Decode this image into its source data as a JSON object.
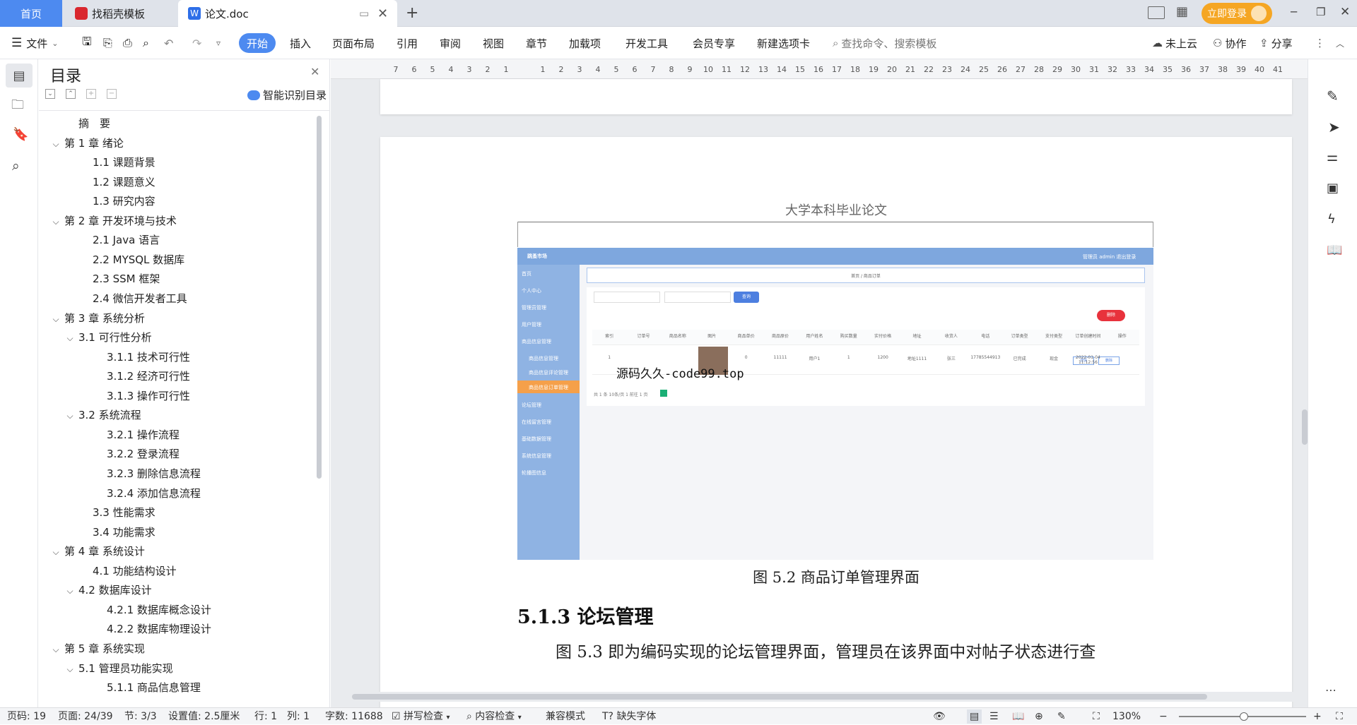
{
  "tabs": {
    "home": "首页",
    "template": "找稻壳模板",
    "doc": "论文.doc"
  },
  "titlebar": {
    "login_button": "立即登录"
  },
  "menu": {
    "file": "文件",
    "items": [
      "开始",
      "插入",
      "页面布局",
      "引用",
      "审阅",
      "视图",
      "章节",
      "加载项",
      "开发工具",
      "会员专享",
      "新建选项卡"
    ],
    "search_placeholder": "查找命令、搜索模板",
    "cloud": "未上云",
    "collab": "协作",
    "share": "分享"
  },
  "toc": {
    "title": "目录",
    "smart": "智能识别目录",
    "items": [
      "摘　要",
      "第 1 章  绪论",
      "1.1  课题背景",
      "1.2  课题意义",
      "1.3  研究内容",
      "第 2 章  开发环境与技术",
      "2.1 Java 语言",
      "2.2 MYSQL 数据库",
      "2.3 SSM 框架",
      "2.4 微信开发者工具",
      "第 3 章  系统分析",
      "3.1  可行性分析",
      "3.1.1  技术可行性",
      "3.1.2  经济可行性",
      "3.1.3  操作可行性",
      "3.2  系统流程",
      "3.2.1  操作流程",
      "3.2.2  登录流程",
      "3.2.3  删除信息流程",
      "3.2.4  添加信息流程",
      "3.3  性能需求",
      "3.4  功能需求",
      "第 4 章  系统设计",
      "4.1  功能结构设计",
      "4.2  数据库设计",
      "4.2.1  数据库概念设计",
      "4.2.2  数据库物理设计",
      "第 5 章  系统实现",
      "5.1  管理员功能实现",
      "5.1.1  商品信息管理"
    ]
  },
  "ruler": [
    "7",
    "6",
    "5",
    "4",
    "3",
    "2",
    "1",
    "",
    "1",
    "2",
    "3",
    "4",
    "5",
    "6",
    "7",
    "8",
    "9",
    "10",
    "11",
    "12",
    "13",
    "14",
    "15",
    "16",
    "17",
    "18",
    "19",
    "20",
    "21",
    "22",
    "23",
    "24",
    "25",
    "26",
    "27",
    "28",
    "29",
    "30",
    "31",
    "32",
    "33",
    "34",
    "35",
    "36",
    "37",
    "38",
    "39",
    "40",
    "41"
  ],
  "document": {
    "header": "大学本科毕业论文",
    "watermark": "源码久久-code99.top",
    "caption": "图 5.2  商品订单管理界面",
    "section": "5.1.3  论坛管理",
    "paragraph": "图 5.3  即为编码实现的论坛管理界面，管理员在该界面中对帖子状态进行查",
    "shot": {
      "brand": "跳蚤市场",
      "user": "管理员 admin    退出登录",
      "breadcrumb": "首页 / 商品订单",
      "nav": [
        "首页",
        "个人中心",
        "管理员管理",
        "用户管理",
        "商品信息管理",
        "商品信息管理",
        "商品信息评论管理",
        "商品信息订单管理",
        "论坛管理",
        "在线留言管理",
        "基础数据管理",
        "系统信息管理",
        "轮播图信息"
      ],
      "search_btn": "查询",
      "delete_btn": "删除",
      "columns": [
        "索引",
        "订单号",
        "商品名称",
        "图片",
        "商品单价",
        "商品原价",
        "用户姓名",
        "购买数量",
        "实付价格",
        "地址",
        "收货人",
        "电话",
        "订单类型",
        "支付类型",
        "订单创建时间",
        "操作"
      ],
      "row": [
        "1",
        "",
        "",
        "",
        "0",
        "11111",
        "用户1",
        "1",
        "1200",
        "地址1111",
        "张三",
        "17785544913",
        "已完成",
        "现金",
        "2022-01-04 11:12:56",
        "详情  删除"
      ],
      "pager": "共 1 条    10条/页    1    前往  1  页"
    }
  },
  "status": {
    "page": "页码: 19",
    "pages": "页面: 24/39",
    "section": "节: 3/3",
    "setting": "设置值: 2.5厘米",
    "row": "行: 1",
    "col": "列: 1",
    "words": "字数: 11688",
    "spell": "拼写检查",
    "content": "内容检查",
    "compat": "兼容模式",
    "font": "缺失字体",
    "zoom": "130%"
  }
}
